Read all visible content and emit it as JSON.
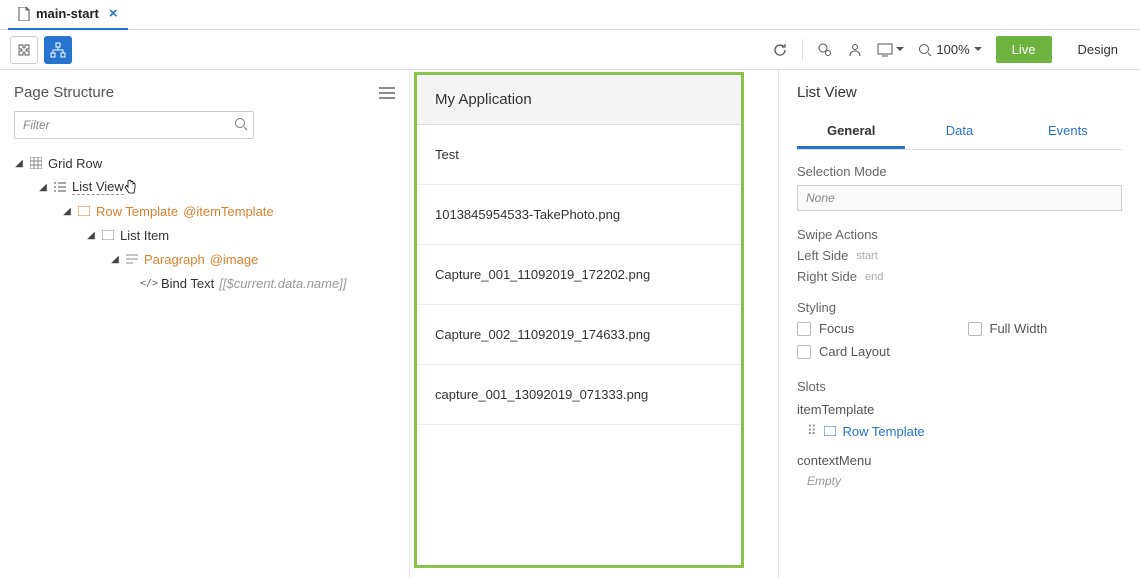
{
  "tab": {
    "name": "main-start"
  },
  "toolbar": {
    "zoom": "100%",
    "live": "Live",
    "design": "Design"
  },
  "page_structure": {
    "title": "Page Structure",
    "filter_placeholder": "Filter",
    "tree": {
      "grid_row": "Grid Row",
      "list_view": "List View",
      "row_template": "Row Template",
      "row_template_decor": "@itemTemplate",
      "list_item": "List Item",
      "paragraph": "Paragraph",
      "paragraph_decor": "@image",
      "bind_text": "Bind Text",
      "bind_text_decor": "[[$current.data.name]]"
    }
  },
  "canvas": {
    "header": "My Application",
    "items": [
      "Test",
      "1013845954533-TakePhoto.png",
      "Capture_001_11092019_172202.png",
      "Capture_002_11092019_174633.png",
      "capture_001_13092019_071333.png"
    ]
  },
  "inspector": {
    "title": "List View",
    "tabs": {
      "general": "General",
      "data": "Data",
      "events": "Events"
    },
    "selection_mode_label": "Selection Mode",
    "selection_mode_value": "None",
    "swipe_label": "Swipe Actions",
    "left_side": "Left Side",
    "left_hint": "start",
    "right_side": "Right Side",
    "right_hint": "end",
    "styling_label": "Styling",
    "focus": "Focus",
    "full_width": "Full Width",
    "card_layout": "Card Layout",
    "slots_label": "Slots",
    "item_template": "itemTemplate",
    "row_template": "Row Template",
    "context_menu": "contextMenu",
    "empty": "Empty"
  }
}
